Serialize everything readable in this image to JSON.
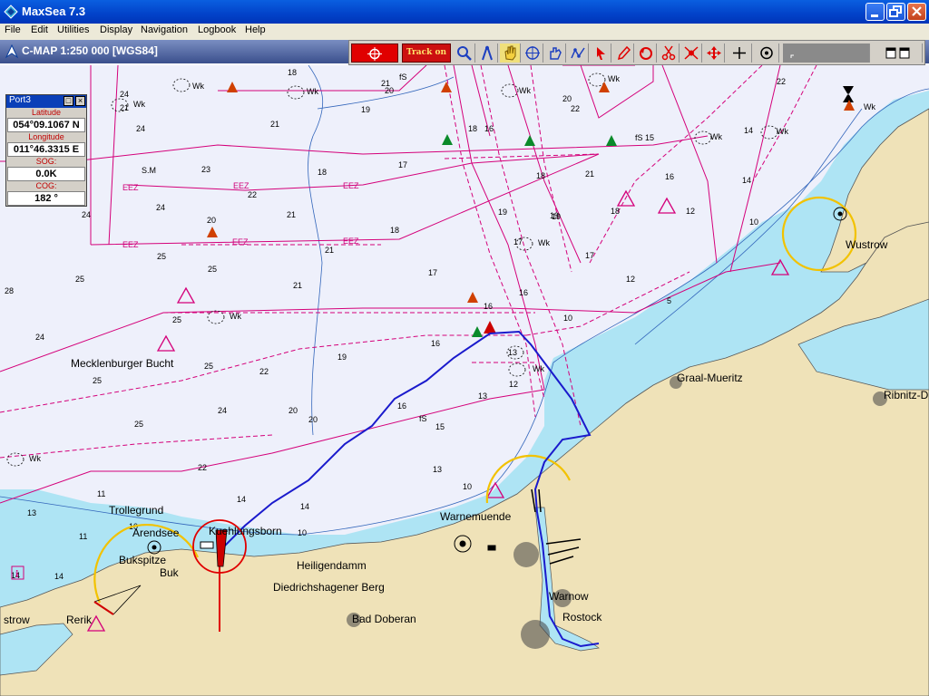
{
  "window": {
    "title": "MaxSea 7.3"
  },
  "menu": [
    "File",
    "Edit",
    "Utilities",
    "Display",
    "Navigation",
    "Logbook",
    "Help"
  ],
  "chart_info": {
    "label": "C-MAP   1:250 000 [WGS84]"
  },
  "toolbar": {
    "track_label": "Track on"
  },
  "panel": {
    "title": "Port3",
    "lat_label": "Latitude",
    "lat_value": "054°09.1067 N",
    "lon_label": "Longitude",
    "lon_value": "011°46.3315 E",
    "sog_label": "SOG:",
    "sog_value": "0.0K",
    "cog_label": "COG:",
    "cog_value": "182 °"
  },
  "places": {
    "mecklenburger_bucht": "Mecklenburger Bucht",
    "wustrow_east": "Wustrow",
    "graal_mueritz": "Graal-Mueritz",
    "ribnitz": "Ribnitz-D",
    "trollegrund": "Trollegrund",
    "arendsee": "Arendsee",
    "kuehlungsborn": "Kuehlungsborn",
    "warnemuende": "Warnemuende",
    "bukspitze": "Bukspitze",
    "buk": "Buk",
    "heiligendamm": "Heiligendamm",
    "diedrichshagener": "Diedrichshagener Berg",
    "warnow": "Warnow",
    "rostock": "Rostock",
    "bad_doberan": "Bad Doberan",
    "rerik": "Rerik",
    "wustrow_west": "strow"
  },
  "depths": [
    "24",
    "21",
    "24",
    "21",
    "24",
    "24",
    "25",
    "28",
    "25",
    "25",
    "24",
    "25",
    "25",
    "25",
    "24",
    "22",
    "25",
    "21",
    "23",
    "22",
    "21",
    "20",
    "22",
    "19",
    "18",
    "19",
    "18",
    "21",
    "17",
    "18",
    "21",
    "21",
    "22",
    "22",
    "19",
    "18",
    "17",
    "19",
    "18",
    "17",
    "16",
    "16",
    "16",
    "16",
    "15",
    "13",
    "13",
    "11",
    "14",
    "14",
    "10",
    "11",
    "12",
    "12",
    "12",
    "16",
    "15",
    "14",
    "14",
    "13",
    "5",
    "20",
    "19",
    "18",
    "17",
    "16",
    "14",
    "13",
    "14"
  ],
  "depth_labels": {
    "d_s_m": "S.M",
    "d_fs1": "fS",
    "d_fs2": "fS",
    "d_fs3": "fS",
    "d_10_a": "10",
    "d_10_b": "10",
    "d_10_c": "10",
    "d_10_d": "10",
    "d_20_a": "20",
    "d_20_b": "20",
    "d_20_c": "20"
  },
  "eez_label": "EEZ",
  "wk_label": "Wk",
  "colors": {
    "sea_deep": "#eef0fb",
    "sea_shallow": "#aee4f4",
    "land": "#efe2b8",
    "route": "#1a1acc",
    "restricted": "#d4007a",
    "light_sector": "#f2c200",
    "boat": "#cc0000"
  }
}
